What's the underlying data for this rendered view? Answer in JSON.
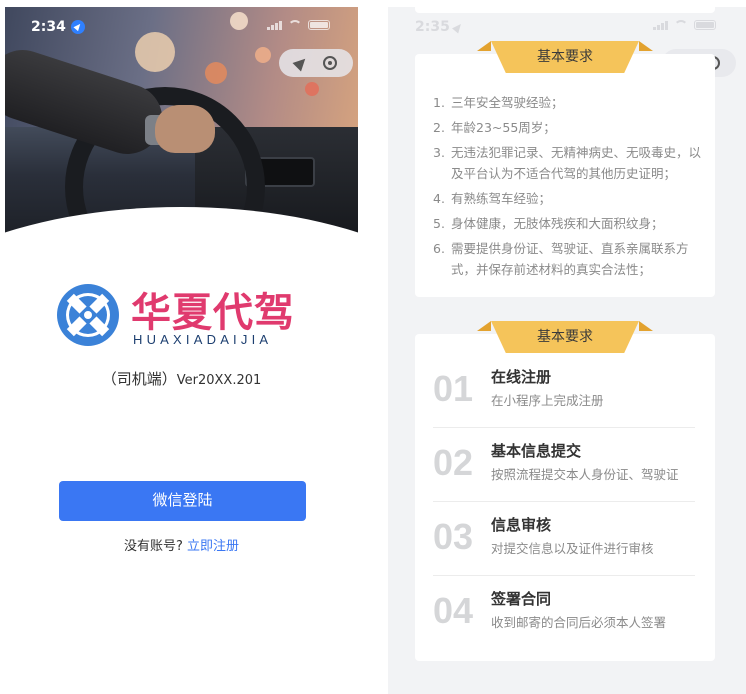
{
  "left_screen": {
    "status": {
      "time": "2:34"
    },
    "brand": {
      "name_cn": "华夏代驾",
      "name_en": "HUAXIADAIJIA"
    },
    "version": {
      "label": "（司机端）",
      "number": "Ver20XX.201"
    },
    "login_button": "微信登陆",
    "register": {
      "prompt": "没有账号?",
      "link": "立即注册"
    },
    "colors": {
      "accent": "#3a77f3",
      "brand_pink": "#e03a6e",
      "brand_blue": "#1d3f70"
    }
  },
  "right_screen": {
    "status": {
      "time": "2:35"
    },
    "requirements_card": {
      "title": "基本要求",
      "items": [
        {
          "num": "1.",
          "text": "三年安全驾驶经验；"
        },
        {
          "num": "2.",
          "text": "年龄23~55周岁；"
        },
        {
          "num": "3.",
          "text": "无违法犯罪记录、无精神病史、无吸毒史，以及平台认为不适合代驾的其他历史证明；"
        },
        {
          "num": "4.",
          "text": "有熟练驾车经验；"
        },
        {
          "num": "5.",
          "text": "身体健康，无肢体残疾和大面积纹身；"
        },
        {
          "num": "6.",
          "text": "需要提供身份证、驾驶证、直系亲属联系方式，并保存前述材料的真实合法性；"
        }
      ]
    },
    "process_card": {
      "title": "基本要求",
      "steps": [
        {
          "num": "01",
          "title": "在线注册",
          "desc": "在小程序上完成注册"
        },
        {
          "num": "02",
          "title": "基本信息提交",
          "desc": "按照流程提交本人身份证、驾驶证"
        },
        {
          "num": "03",
          "title": "信息审核",
          "desc": "对提交信息以及证件进行审核"
        },
        {
          "num": "04",
          "title": "签署合同",
          "desc": "收到邮寄的合同后必须本人签署"
        }
      ]
    },
    "colors": {
      "ribbon": "#f5c45a",
      "ribbon_dark": "#e3a22f",
      "background": "#f2f3f5"
    }
  }
}
